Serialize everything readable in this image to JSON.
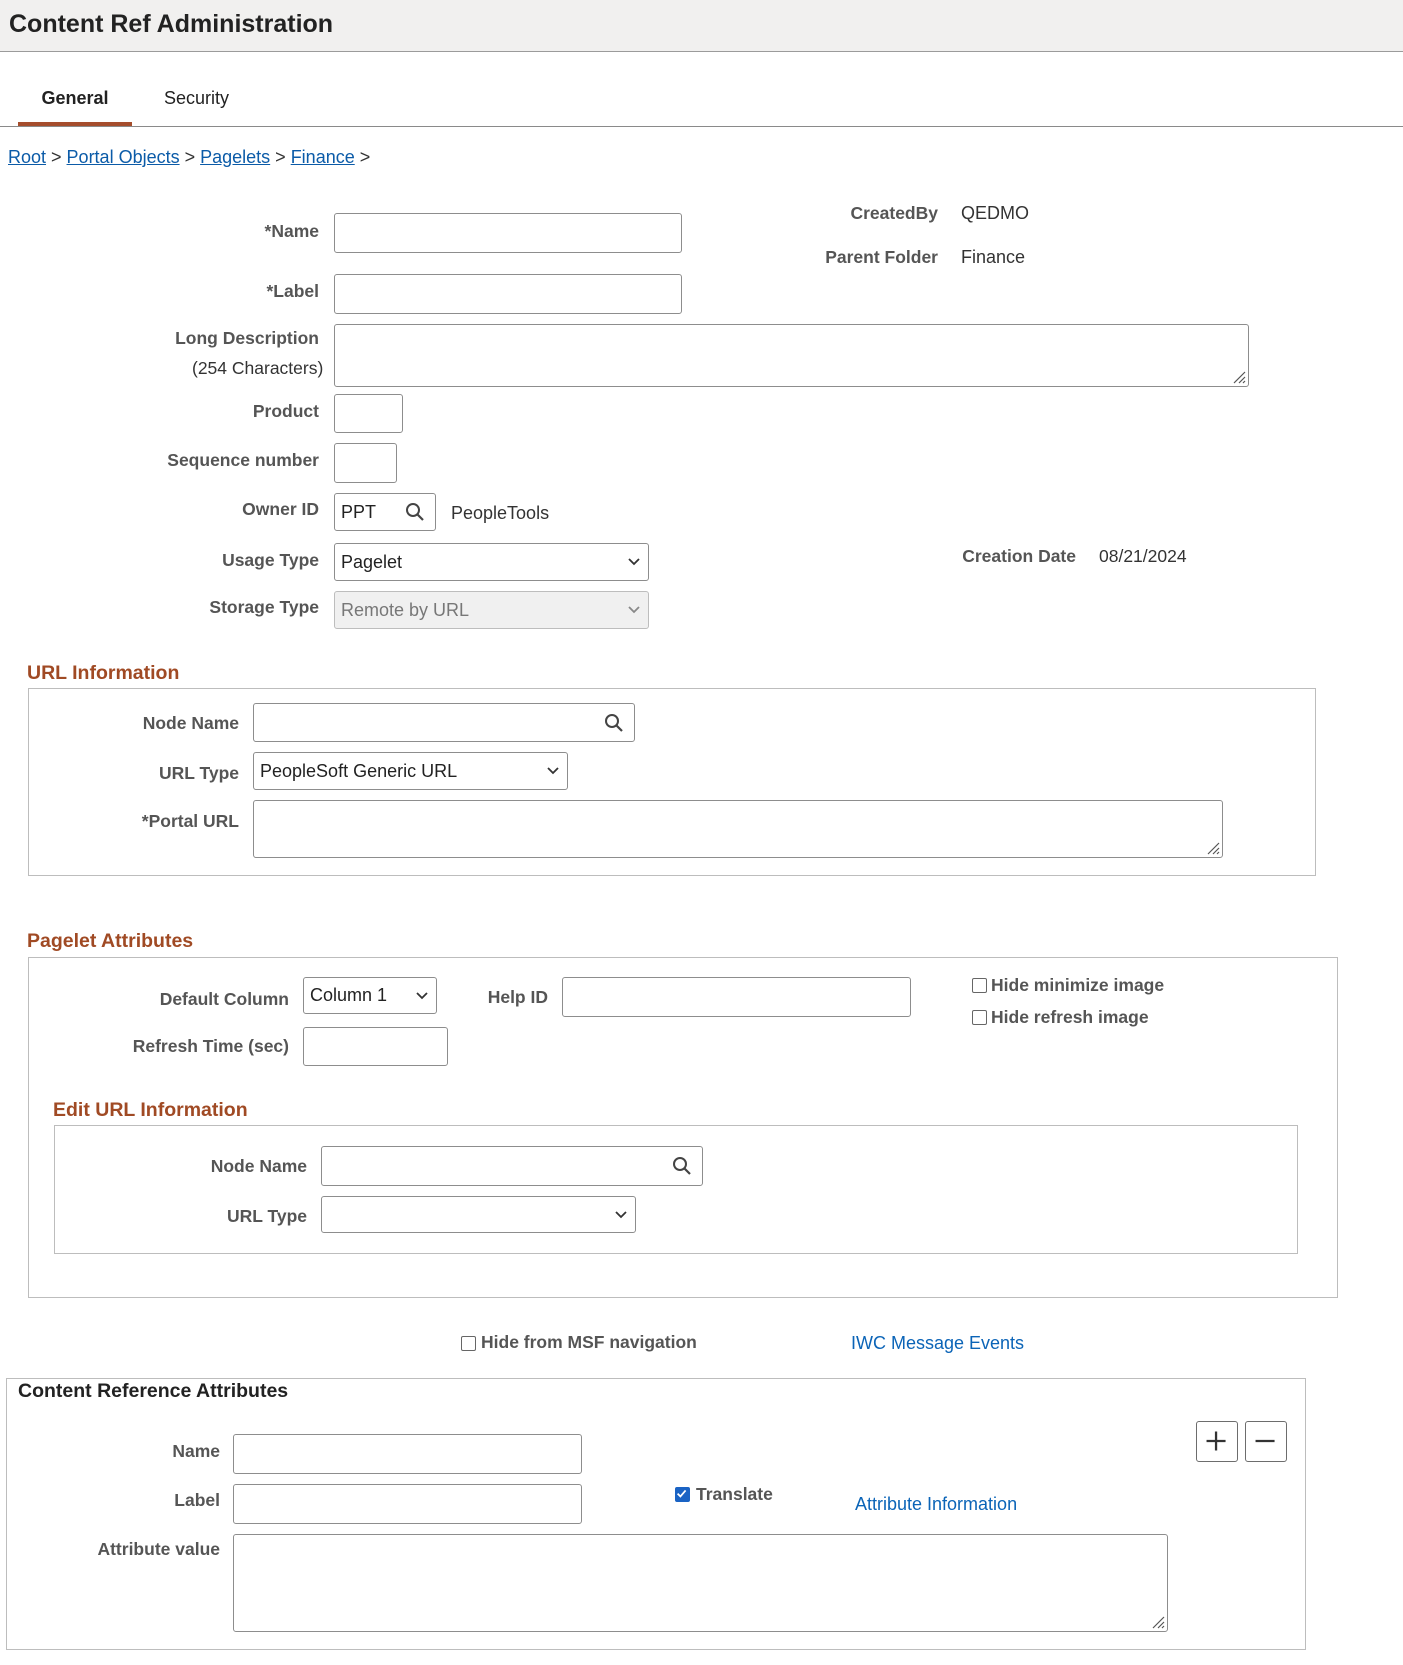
{
  "header": {
    "title": "Content Ref Administration"
  },
  "tabs": [
    {
      "label": "General"
    },
    {
      "label": "Security"
    }
  ],
  "breadcrumb": [
    {
      "label": "Root"
    },
    {
      "label": "Portal Objects"
    },
    {
      "label": "Pagelets"
    },
    {
      "label": "Finance"
    }
  ],
  "breadcrumb_sep": ">",
  "general": {
    "name_label": "*Name",
    "label_label": "*Label",
    "long_desc_label": "Long Description",
    "long_desc_hint": "(254 Characters)",
    "product_label": "Product",
    "sequence_label": "Sequence number",
    "owner_label": "Owner ID",
    "owner_value": "PPT",
    "owner_desc": "PeopleTools",
    "usage_label": "Usage Type",
    "usage_value": "Pagelet",
    "storage_label": "Storage Type",
    "storage_value": "Remote by URL",
    "created_by_label": "CreatedBy",
    "created_by_value": "QEDMO",
    "parent_folder_label": "Parent Folder",
    "parent_folder_value": "Finance",
    "creation_date_label": "Creation Date",
    "creation_date_value": "08/21/2024"
  },
  "url_info": {
    "title": "URL Information",
    "node_label": "Node Name",
    "url_type_label": "URL Type",
    "url_type_value": "PeopleSoft Generic URL",
    "portal_url_label": "*Portal URL"
  },
  "pagelet_attrs": {
    "title": "Pagelet Attributes",
    "default_column_label": "Default Column",
    "default_column_value": "Column 1",
    "help_id_label": "Help ID",
    "refresh_label": "Refresh Time (sec)",
    "hide_minimize_label": "Hide minimize image",
    "hide_refresh_label": "Hide refresh image"
  },
  "edit_url": {
    "title": "Edit URL Information",
    "node_label": "Node Name",
    "url_type_label": "URL Type"
  },
  "misc": {
    "hide_msf_label": "Hide from MSF navigation",
    "iwc_link": "IWC Message Events"
  },
  "cref_attrs": {
    "title": "Content Reference Attributes",
    "name_label": "Name",
    "label_label": "Label",
    "translate_label": "Translate",
    "translate_checked": true,
    "attr_info_link": "Attribute Information",
    "attr_value_label": "Attribute value"
  },
  "colors": {
    "accent": "#a54d2c",
    "section": "#a04a24",
    "link": "#0b5ba8",
    "checkbox": "#1a63c4"
  }
}
